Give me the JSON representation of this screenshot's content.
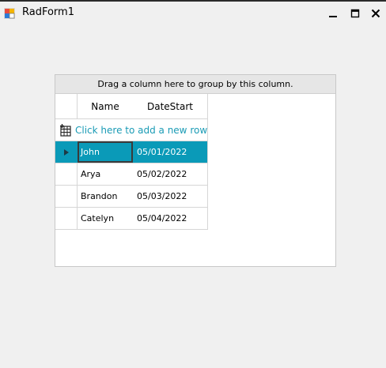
{
  "window": {
    "title": "RadForm1",
    "colors": {
      "accent": "#0a9ab8",
      "link": "#1a9bb5"
    }
  },
  "grid": {
    "group_panel_text": "Drag a column here to group by this column.",
    "columns": [
      "Name",
      "DateStart"
    ],
    "new_row_text": "Click here to add a new row",
    "rows": [
      {
        "name": "John",
        "date": "05/01/2022",
        "selected": true
      },
      {
        "name": "Arya",
        "date": "05/02/2022",
        "selected": false
      },
      {
        "name": "Brandon",
        "date": "05/03/2022",
        "selected": false
      },
      {
        "name": "Catelyn",
        "date": "05/04/2022",
        "selected": false
      }
    ]
  }
}
